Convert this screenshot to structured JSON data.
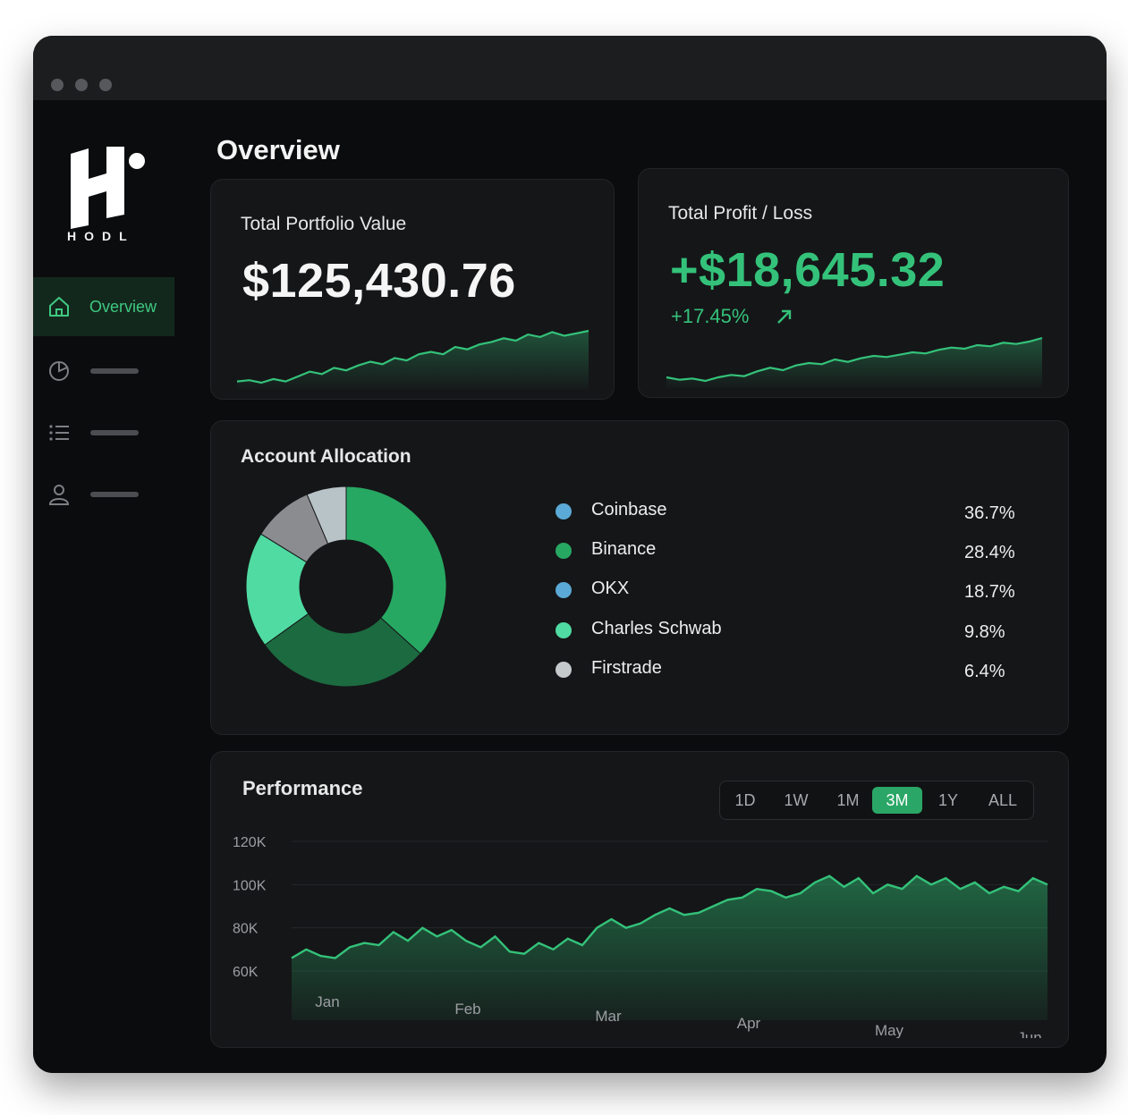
{
  "brand": {
    "name": "HODL"
  },
  "sidebar": {
    "items": [
      {
        "label": "Overview",
        "icon": "home-icon",
        "active": true
      },
      {
        "label": "",
        "icon": "pie-chart-icon",
        "active": false
      },
      {
        "label": "",
        "icon": "list-icon",
        "active": false
      },
      {
        "label": "",
        "icon": "user-icon",
        "active": false
      }
    ]
  },
  "main": {
    "title": "Overview"
  },
  "portfolio": {
    "label": "Total Portfolio Value",
    "value": "$125,430.76",
    "sparkline": [
      6,
      7,
      5,
      8,
      6,
      10,
      14,
      12,
      17,
      15,
      19,
      22,
      20,
      25,
      23,
      28,
      30,
      28,
      34,
      32,
      36,
      38,
      41,
      39,
      44,
      42,
      46,
      43,
      45,
      47
    ]
  },
  "profit": {
    "label": "Total Profit / Loss",
    "value": "+$18,645.32",
    "percent": "+17.45%",
    "trend_icon": "arrow-up-right-icon",
    "sparkline": [
      8,
      6,
      7,
      5,
      8,
      10,
      9,
      13,
      16,
      14,
      18,
      20,
      19,
      23,
      21,
      24,
      26,
      25,
      27,
      29,
      28,
      31,
      33,
      32,
      35,
      34,
      37,
      36,
      38,
      41
    ]
  },
  "allocation": {
    "title": "Account Allocation",
    "items": [
      {
        "name": "Coinbase",
        "percent": "36.7%",
        "value": 36.7,
        "color": "#5aa9d6",
        "chart_color": "#27a862"
      },
      {
        "name": "Binance",
        "percent": "28.4%",
        "value": 28.4,
        "color": "#27a862",
        "chart_color": "#1c6a40"
      },
      {
        "name": "OKX",
        "percent": "18.7%",
        "value": 18.7,
        "color": "#5aa9d6",
        "chart_color": "#4fdba1"
      },
      {
        "name": "Charles Schwab",
        "percent": "9.8%",
        "value": 9.8,
        "color": "#4fdba1",
        "chart_color": "#8a8c8f"
      },
      {
        "name": "Firstrade",
        "percent": "6.4%",
        "value": 6.4,
        "color": "#c5c9cc",
        "chart_color": "#b8c3c7"
      }
    ]
  },
  "performance": {
    "title": "Performance",
    "ranges": [
      "1D",
      "1W",
      "1M",
      "3M",
      "1Y",
      "ALL"
    ],
    "active_range": "3M"
  },
  "chart_data": {
    "type": "area",
    "title": "Performance",
    "x": [
      "Jan",
      "Feb",
      "Mar",
      "Apr",
      "May",
      "Jun"
    ],
    "y_ticks": [
      "120K",
      "100K",
      "80K",
      "60K"
    ],
    "ylim": [
      60000,
      120000
    ],
    "values": [
      66000,
      70000,
      67000,
      66000,
      71000,
      73000,
      72000,
      78000,
      74000,
      80000,
      76000,
      79000,
      74000,
      71000,
      76000,
      69000,
      68000,
      73000,
      70000,
      75000,
      72000,
      80000,
      84000,
      80000,
      82000,
      86000,
      89000,
      86000,
      87000,
      90000,
      93000,
      94000,
      98000,
      97000,
      94000,
      96000,
      101000,
      104000,
      99000,
      103000,
      96000,
      100000,
      98000,
      104000,
      100000,
      103000,
      98000,
      101000,
      96000,
      99000,
      97000,
      103000,
      100000
    ],
    "color": "#34c27a",
    "grid": true
  }
}
